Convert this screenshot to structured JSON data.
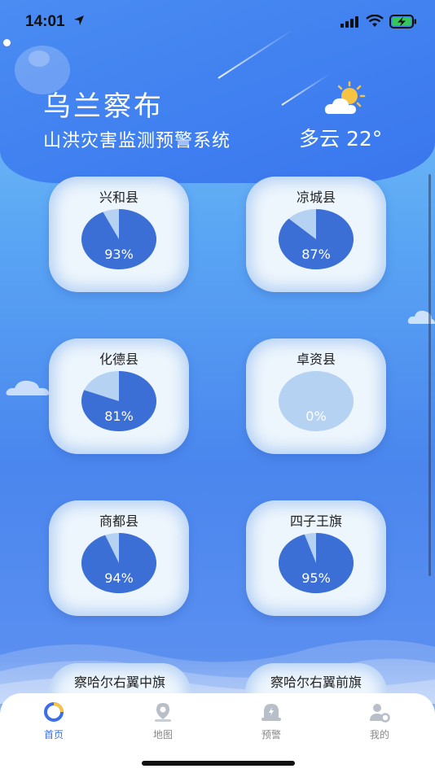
{
  "status_bar": {
    "time": "14:01"
  },
  "header": {
    "city": "乌兰察布",
    "system_title": "山洪灾害监测预警系统",
    "weather": "多云 22°"
  },
  "cards": [
    {
      "name": "兴和县",
      "percent": 93,
      "label": "93%"
    },
    {
      "name": "凉城县",
      "percent": 87,
      "label": "87%"
    },
    {
      "name": "化德县",
      "percent": 81,
      "label": "81%"
    },
    {
      "name": "卓资县",
      "percent": 0,
      "label": "0%"
    },
    {
      "name": "商都县",
      "percent": 94,
      "label": "94%"
    },
    {
      "name": "四子王旗",
      "percent": 95,
      "label": "95%"
    },
    {
      "name": "察哈尔右翼中旗"
    },
    {
      "name": "察哈尔右翼前旗"
    }
  ],
  "colors": {
    "pie_fill": "#3b6fd6",
    "pie_rest": "#b6d2f2",
    "accent": "#3a6fe8"
  },
  "tabbar": [
    {
      "label": "首页",
      "icon": "home-icon",
      "active": true
    },
    {
      "label": "地图",
      "icon": "map-pin-icon",
      "active": false
    },
    {
      "label": "预警",
      "icon": "alarm-icon",
      "active": false
    },
    {
      "label": "我的",
      "icon": "user-settings-icon",
      "active": false
    }
  ]
}
